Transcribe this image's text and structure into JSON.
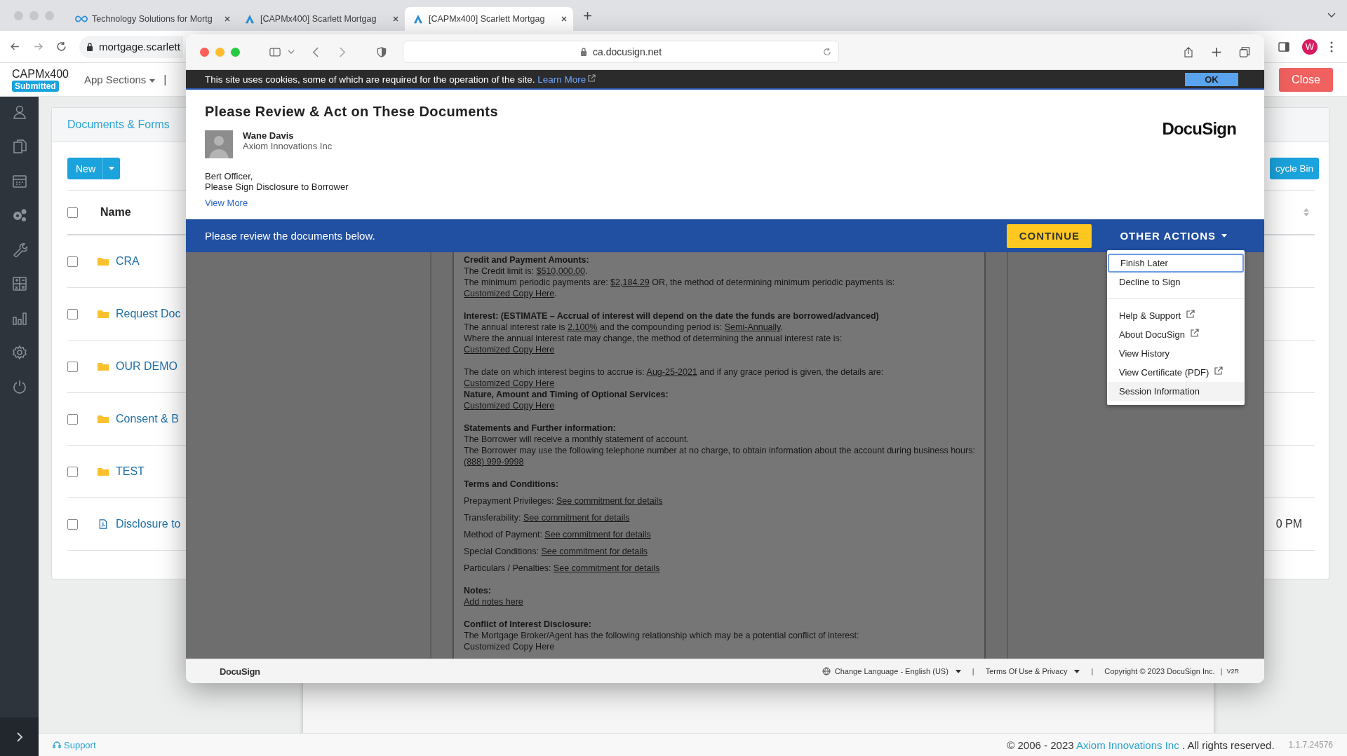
{
  "browser": {
    "tabs": [
      {
        "title": "Technology Solutions for Mortg",
        "kind": "infinity",
        "selected": false
      },
      {
        "title": "[CAPMx400] Scarlett Mortgag",
        "kind": "app",
        "selected": false
      },
      {
        "title": "[CAPMx400] Scarlett Mortgag",
        "kind": "app",
        "selected": true
      }
    ],
    "url": "mortgage.scarlett",
    "avatar": "W"
  },
  "app": {
    "name": "CAPMx400",
    "status": "Submitted",
    "menu": "App Sections",
    "separator": "|",
    "close": "Close",
    "panel_title": "Documents & Forms",
    "new_button": "New",
    "recycle_button": "cycle Bin",
    "name_header": "Name",
    "select_all_checked": false,
    "rows": [
      {
        "name": "CRA",
        "kind": "folder",
        "checked": false
      },
      {
        "name": "Request Doc",
        "kind": "folder",
        "checked": false
      },
      {
        "name": "OUR DEMO",
        "kind": "folder",
        "checked": false
      },
      {
        "name": "Consent & B",
        "kind": "folder",
        "checked": false
      },
      {
        "name": "TEST",
        "kind": "folder",
        "checked": false
      },
      {
        "name": "Disclosure to",
        "kind": "file",
        "checked": false,
        "time": "0 PM"
      }
    ],
    "support": "Support",
    "copyright_prefix": "© 2006 - 2023",
    "company": "Axiom Innovations Inc",
    "copyright_suffix": ". All rights reserved.",
    "version": "1.1.7.24576"
  },
  "docusign": {
    "url": "ca.docusign.net",
    "cookie_text": "This site uses cookies, some of which are required for the operation of the site.",
    "learn_more": "Learn More",
    "ok": "OK",
    "title": "Please Review & Act on These Documents",
    "logo": "DocuSign",
    "sender": {
      "name": "Wane Davis",
      "company": "Axiom Innovations Inc"
    },
    "message": [
      "Bert Officer,",
      "Please Sign Disclosure to Borrower"
    ],
    "view_more": "View More",
    "review_text": "Please review the documents below.",
    "continue": "CONTINUE",
    "other_actions": "OTHER ACTIONS",
    "menu_sections": [
      [
        {
          "label": "Finish Later",
          "external": false,
          "selected": true,
          "hovered": false
        },
        {
          "label": "Decline to Sign",
          "external": false,
          "selected": false,
          "hovered": false
        }
      ],
      [
        {
          "label": "Help & Support",
          "external": true,
          "selected": false,
          "hovered": false
        },
        {
          "label": "About DocuSign",
          "external": true,
          "selected": false,
          "hovered": false
        },
        {
          "label": "View History",
          "external": false,
          "selected": false,
          "hovered": false
        },
        {
          "label": "View Certificate (PDF)",
          "external": true,
          "selected": false,
          "hovered": false
        },
        {
          "label": "Session Information",
          "external": false,
          "selected": false,
          "hovered": true
        }
      ]
    ],
    "document": [
      [
        {
          "kind": "heading",
          "parts": [
            {
              "text": "Credit and Payment Amounts:",
              "underline": false
            }
          ]
        },
        {
          "kind": "text",
          "parts": [
            {
              "text": "The Credit limit is: ",
              "underline": false
            },
            {
              "text": "$510,000.00",
              "underline": true
            },
            {
              "text": ".",
              "underline": false
            }
          ]
        },
        {
          "kind": "text",
          "parts": [
            {
              "text": "The minimum periodic payments are: ",
              "underline": false
            },
            {
              "text": "$2,184.29",
              "underline": true
            },
            {
              "text": " OR, the method of determining minimum periodic payments is:",
              "underline": false
            }
          ]
        },
        {
          "kind": "text",
          "parts": [
            {
              "text": "Customized Copy Here",
              "underline": true
            },
            {
              "text": ".",
              "underline": false
            }
          ]
        }
      ],
      [
        {
          "kind": "heading",
          "parts": [
            {
              "text": "Interest: (ESTIMATE – Accrual of interest will depend on the date the funds are borrowed/advanced)",
              "underline": false
            }
          ]
        },
        {
          "kind": "text",
          "parts": [
            {
              "text": "The annual interest rate is ",
              "underline": false
            },
            {
              "text": "2.100%",
              "underline": true
            },
            {
              "text": " and the compounding period is: ",
              "underline": false
            },
            {
              "text": "Semi-Annually",
              "underline": true
            },
            {
              "text": ".",
              "underline": false
            }
          ]
        },
        {
          "kind": "text",
          "parts": [
            {
              "text": "Where the annual interest rate may change, the method of determining the annual interest rate is:",
              "underline": false
            }
          ]
        },
        {
          "kind": "text",
          "parts": [
            {
              "text": "Customized Copy Here",
              "underline": true
            }
          ]
        }
      ],
      [
        {
          "kind": "text",
          "parts": [
            {
              "text": "The date on which interest begins to accrue is: ",
              "underline": false
            },
            {
              "text": "Aug-25-2021",
              "underline": true
            },
            {
              "text": " and if any grace period is given, the details are:",
              "underline": false
            }
          ]
        },
        {
          "kind": "text",
          "parts": [
            {
              "text": "Customized Copy Here",
              "underline": true
            }
          ]
        },
        {
          "kind": "heading",
          "parts": [
            {
              "text": "Nature, Amount and Timing of Optional Services:",
              "underline": false
            }
          ]
        },
        {
          "kind": "text",
          "parts": [
            {
              "text": "Customized Copy Here",
              "underline": true
            }
          ]
        }
      ],
      [
        {
          "kind": "heading",
          "parts": [
            {
              "text": "Statements and Further information:",
              "underline": false
            }
          ]
        },
        {
          "kind": "text",
          "parts": [
            {
              "text": "The Borrower will receive a monthly statement of account.",
              "underline": false
            }
          ]
        },
        {
          "kind": "text",
          "parts": [
            {
              "text": "The Borrower may use the following telephone number at no charge, to obtain information about the account during business hours: ",
              "underline": false
            },
            {
              "text": "(888) 999-9998",
              "underline": true
            }
          ]
        }
      ],
      [
        {
          "kind": "heading",
          "parts": [
            {
              "text": "Terms and Conditions:",
              "underline": false
            }
          ]
        },
        {
          "kind": "spaced",
          "parts": [
            {
              "text": "Prepayment Privileges: ",
              "underline": false
            },
            {
              "text": "See commitment for details",
              "underline": true
            }
          ]
        },
        {
          "kind": "spaced",
          "parts": [
            {
              "text": "Transferability: ",
              "underline": false
            },
            {
              "text": "See commitment for details",
              "underline": true
            }
          ]
        },
        {
          "kind": "spaced",
          "parts": [
            {
              "text": "Method of Payment: ",
              "underline": false
            },
            {
              "text": "See commitment for details",
              "underline": true
            }
          ]
        },
        {
          "kind": "spaced",
          "parts": [
            {
              "text": "Special Conditions: ",
              "underline": false
            },
            {
              "text": "See commitment for details",
              "underline": true
            }
          ]
        },
        {
          "kind": "spaced",
          "parts": [
            {
              "text": "Particulars / Penalties: ",
              "underline": false
            },
            {
              "text": "See commitment for details",
              "underline": true
            }
          ]
        }
      ],
      [
        {
          "kind": "heading",
          "parts": [
            {
              "text": "Notes:",
              "underline": false
            }
          ]
        },
        {
          "kind": "text",
          "parts": [
            {
              "text": "Add notes here",
              "underline": true
            }
          ]
        }
      ],
      [
        {
          "kind": "heading",
          "parts": [
            {
              "text": "Conflict of Interest Disclosure:",
              "underline": false
            }
          ]
        },
        {
          "kind": "text",
          "parts": [
            {
              "text": "The Mortgage Broker/Agent has the following relationship which may be a potential conflict of interest:",
              "underline": false
            }
          ]
        },
        {
          "kind": "text",
          "parts": [
            {
              "text": "Customized Copy Here",
              "underline": false
            }
          ]
        }
      ]
    ],
    "footer": {
      "logo": "DocuSign",
      "language": "Change Language - English (US)",
      "separator": "|",
      "terms": "Terms Of Use & Privacy",
      "copyright": "Copyright © 2023 DocuSign Inc.",
      "version": "V2R"
    }
  }
}
